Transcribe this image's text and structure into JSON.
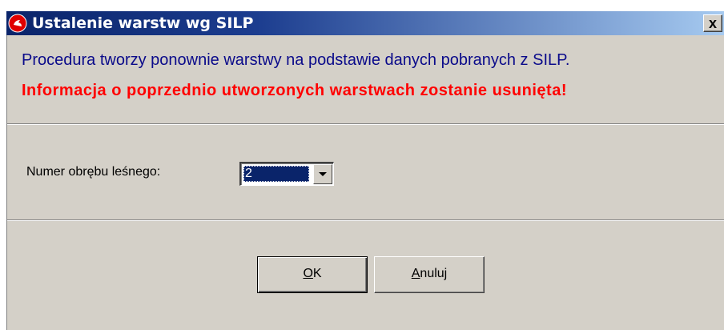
{
  "window": {
    "title": "Ustalenie warstw wg SILP",
    "icon": "red-app-icon",
    "close_label": "x"
  },
  "message": {
    "info": "Procedura tworzy ponownie warstwy na podstawie danych pobranych z SILP.",
    "warning": "Informacja o poprzednio utworzonych warstwach zostanie usunięta!"
  },
  "form": {
    "district_label": "Numer obrębu leśnego:",
    "district_value": "2"
  },
  "buttons": {
    "ok": {
      "mnemonic": "O",
      "rest": "K"
    },
    "cancel": {
      "mnemonic": "A",
      "rest": "nuluj"
    }
  },
  "colors": {
    "title_gradient_start": "#0a246a",
    "title_gradient_end": "#a6caf0",
    "dialog_bg": "#d4d0c8",
    "info_text": "#0a0a8a",
    "warning_text": "#ff0000",
    "selection_bg": "#0a246a"
  }
}
